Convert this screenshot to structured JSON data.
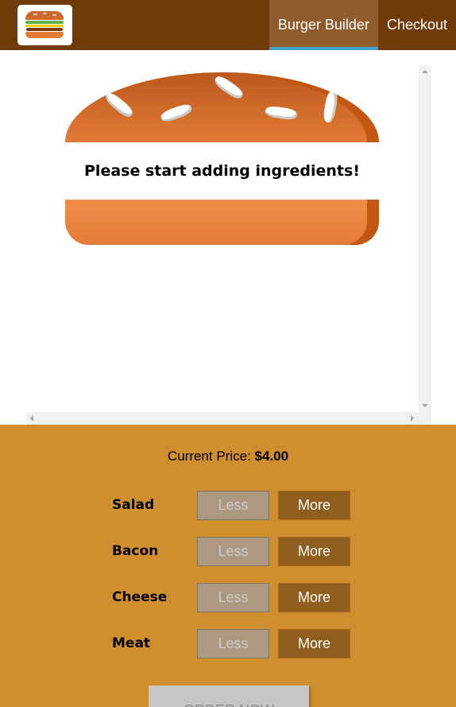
{
  "nav": {
    "items": [
      {
        "label": "Burger Builder",
        "active": true
      },
      {
        "label": "Checkout",
        "active": false
      }
    ]
  },
  "burger": {
    "message": "Please start adding ingredients!"
  },
  "build_controls": {
    "price_label": "Current Price:",
    "price_value": "$4.00",
    "less_label": "Less",
    "more_label": "More",
    "ingredients": [
      {
        "label": "Salad"
      },
      {
        "label": "Bacon"
      },
      {
        "label": "Cheese"
      },
      {
        "label": "Meat"
      }
    ],
    "order_label": "ORDER NOW"
  },
  "colors": {
    "toolbar": "#703b09",
    "nav_active": "#8f5c2c",
    "nav_active_border": "#40a4c8",
    "controls_bg": "#cf8f2e",
    "more_button": "#8f5e1e",
    "less_button_disabled": "#ac9980",
    "bun": "#e27b36"
  },
  "icons": {
    "logo": "burger-logo-icon"
  }
}
